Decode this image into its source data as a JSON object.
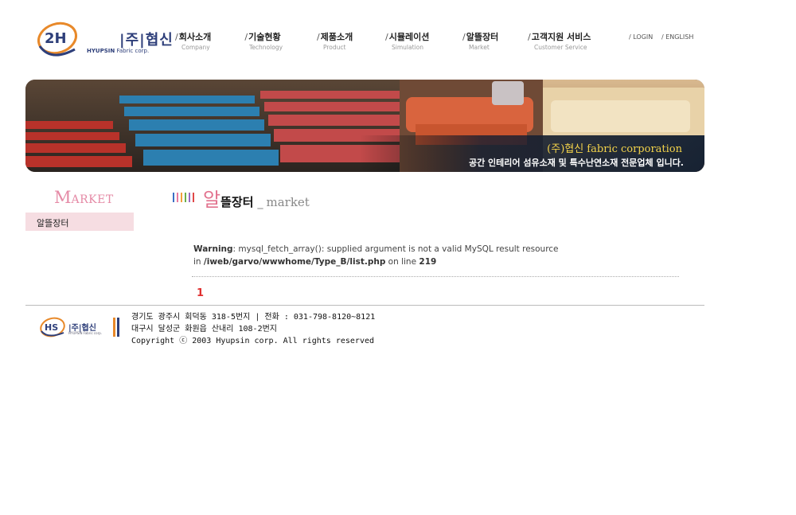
{
  "header": {
    "logo_ko": "|주|협신",
    "logo_en_bold": "HYUPSIN",
    "logo_en_rest": "Fabric corp."
  },
  "nav": [
    {
      "ko": "회사소개",
      "en": "Company"
    },
    {
      "ko": "기술현황",
      "en": "Technology"
    },
    {
      "ko": "제품소개",
      "en": "Product"
    },
    {
      "ko": "시뮬레이션",
      "en": "Simulation"
    },
    {
      "ko": "알뜰장터",
      "en": "Market"
    },
    {
      "ko": "고객지원 서비스",
      "en": "Customer Service"
    }
  ],
  "util": {
    "login": "/ LOGIN",
    "english": "/ ENGLISH"
  },
  "banner": {
    "title": "(주)협신 fabric corporation",
    "subtitle": "공간 인테리어 섬유소재 및 특수난연소재 전문업체 입니다."
  },
  "sidebar": {
    "title_first": "M",
    "title_rest": "ARKET",
    "items": [
      {
        "label": "알뜰장터"
      }
    ]
  },
  "main": {
    "title_first": "알",
    "title_rest": "뜰장터",
    "title_sep": "_",
    "title_en": "market",
    "warning_label": "Warning",
    "warning_msg": ": mysql_fetch_array(): supplied argument is not a valid MySQL result resource",
    "warning_in": "in ",
    "warning_path": "/iweb/garvo/wwwhome/Type_B/list.php",
    "warning_online": " on line ",
    "warning_line": "219",
    "page": "1"
  },
  "footer": {
    "logo_ko": "|주|협신",
    "logo_en": "HYUPSIN Fabric corp.",
    "address1": "경기도 광주시 회덕동 318-5번지 | 전화 : 031-798-8120~8121",
    "address2": "대구시 달성군 화원읍 산내리 108-2번지",
    "copyright": "Copyright ⓒ 2003 Hyupsin corp. All rights reserved"
  },
  "colors": {
    "brand_navy": "#2e3f7a",
    "brand_orange": "#e8892a",
    "market_pink": "#e2728e",
    "sidebar_bg": "#f6dde2",
    "page_red": "#e03030"
  }
}
